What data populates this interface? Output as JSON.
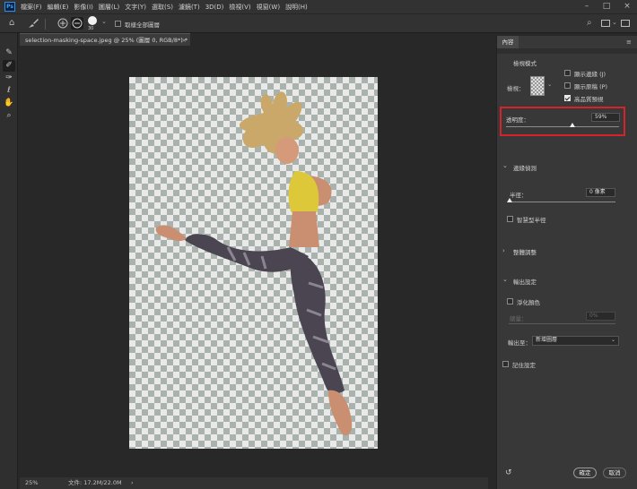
{
  "menubar": {
    "logo": "Ps",
    "items": [
      "檔案(F)",
      "編輯(E)",
      "影像(I)",
      "圖層(L)",
      "文字(Y)",
      "選取(S)",
      "濾鏡(T)",
      "3D(D)",
      "檢視(V)",
      "視窗(W)",
      "說明(H)"
    ]
  },
  "optbar": {
    "brush_size": "30",
    "sample_all_label": "取樣全部圖層"
  },
  "document": {
    "tab_title": "selection-masking-space.jpeg @ 25% (圖層 0, RGB/8*) *",
    "close": "×"
  },
  "status": {
    "zoom": "25%",
    "doc_info": "文件: 17.2M/22.0M",
    "arrow": "›"
  },
  "panel": {
    "tab": "內容",
    "view_mode_title": "檢視模式",
    "view_label": "檢視：",
    "show_edge": "顯示邊緣 (J)",
    "show_original": "顯示原稿 (P)",
    "hq_preview": "高品質預視",
    "opacity_label": "透明度：",
    "opacity_value": "59%",
    "opacity_fraction": 0.59,
    "edge_detection_title": "邊緣偵測",
    "radius_label": "半徑：",
    "radius_value": "0 像素",
    "smart_radius": "智慧型半徑",
    "global_refinements": "整體調整",
    "output_settings": "輸出設定",
    "decontaminate": "淨化顏色",
    "amount_label": "總量：",
    "amount_value": "0%",
    "output_to_label": "輸出至：",
    "output_to_value": "新增圖層",
    "remember": "記住設定",
    "ok": "確定",
    "cancel": "取消"
  },
  "colors": {
    "highlight": "#d8222a",
    "top_color": "#dcc838",
    "hair_color": "#c9a86a"
  }
}
